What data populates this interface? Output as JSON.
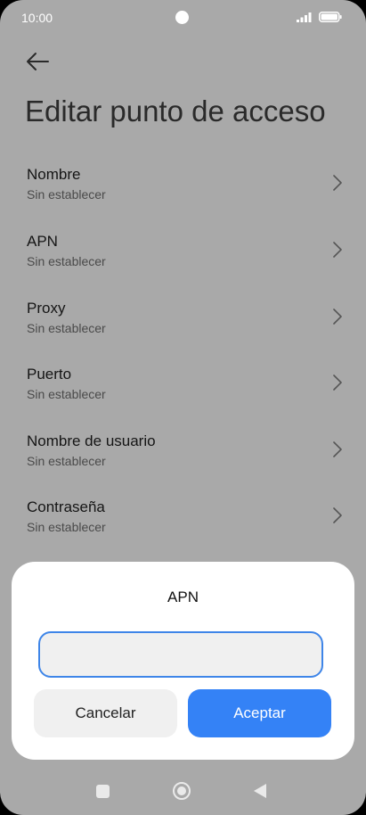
{
  "status_bar": {
    "time": "10:00"
  },
  "header": {
    "title": "Editar punto de acceso"
  },
  "list": {
    "items": [
      {
        "title": "Nombre",
        "value": "Sin establecer"
      },
      {
        "title": "APN",
        "value": "Sin establecer"
      },
      {
        "title": "Proxy",
        "value": "Sin establecer"
      },
      {
        "title": "Puerto",
        "value": "Sin establecer"
      },
      {
        "title": "Nombre de usuario",
        "value": "Sin establecer"
      },
      {
        "title": "Contraseña",
        "value": "Sin establecer"
      }
    ]
  },
  "dialog": {
    "title": "APN",
    "input_value": "",
    "cancel_label": "Cancelar",
    "ok_label": "Aceptar"
  },
  "colors": {
    "accent": "#3482f6",
    "dim_background": "#a9a9a9",
    "sheet": "#ffffff"
  },
  "icons": [
    "back-arrow-icon",
    "chevron-right-icon",
    "signal-icon",
    "battery-icon",
    "recents-icon",
    "home-icon",
    "nav-back-icon"
  ]
}
